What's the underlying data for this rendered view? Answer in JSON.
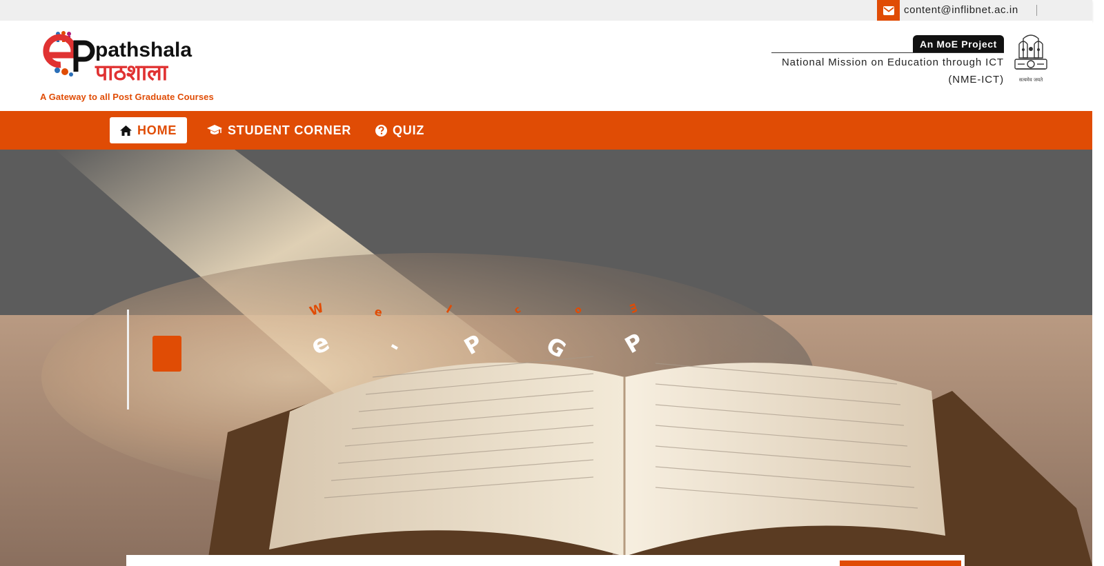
{
  "topbar": {
    "email": "content@inflibnet.ac.in",
    "email_icon": "envelope-icon"
  },
  "header": {
    "logo": {
      "brand_en": "pathshala",
      "brand_hi": "पाठशाला",
      "brand_letters": "e",
      "tagline": "A Gateway to all Post Graduate Courses"
    },
    "moe_badge": "An MoE Project",
    "mission_line1": "National Mission on Education through ICT",
    "mission_line2": "(NME-ICT)",
    "emblem_caption": "सत्यमेव जयते"
  },
  "nav": {
    "items": [
      {
        "label": "HOME",
        "icon": "home-icon",
        "active": true
      },
      {
        "label": "STUDENT CORNER",
        "icon": "graduation-cap-icon",
        "active": false
      },
      {
        "label": "QUIZ",
        "icon": "question-circle-icon",
        "active": false
      }
    ]
  },
  "hero": {
    "small_letters": [
      "W",
      "e",
      "l",
      "c",
      "o",
      "m"
    ],
    "big_letters": [
      "e",
      "-",
      "P",
      "G",
      "P"
    ]
  },
  "colors": {
    "accent": "#e04c05",
    "topbar_bg": "#efefef",
    "hero_overlay": "#5a5a5a",
    "text_dark": "#222222"
  }
}
